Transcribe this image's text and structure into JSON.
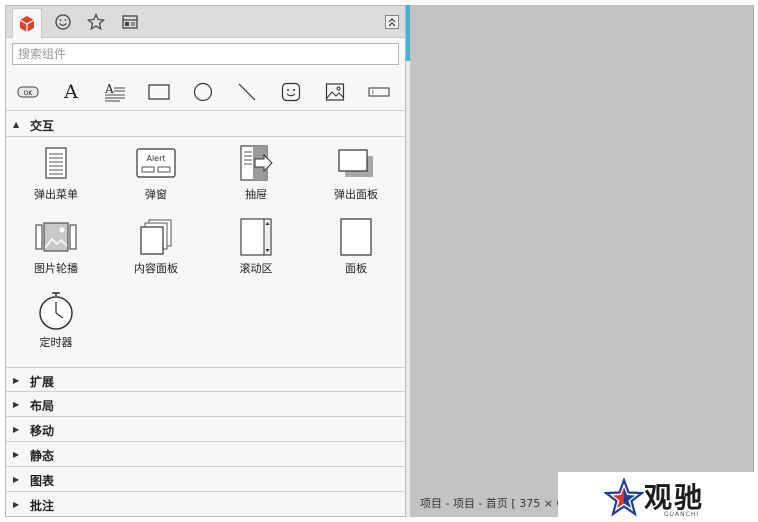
{
  "panel": {
    "tabs": [
      {
        "icon": "cube-icon"
      },
      {
        "icon": "smiley-icon"
      },
      {
        "icon": "star-icon"
      },
      {
        "icon": "layout-icon"
      }
    ],
    "collapse_icon": "double-chevron-up-icon",
    "search_placeholder": "搜索组件",
    "quickbar": [
      {
        "icon": "button-ok-icon",
        "text": "OK"
      },
      {
        "icon": "text-icon",
        "text": "A"
      },
      {
        "icon": "paragraph-icon",
        "text": "A"
      },
      {
        "icon": "rectangle-icon"
      },
      {
        "icon": "circle-icon"
      },
      {
        "icon": "line-icon"
      },
      {
        "icon": "smiley-shape-icon"
      },
      {
        "icon": "image-icon"
      },
      {
        "icon": "input-field-icon",
        "text": "I"
      }
    ],
    "expanded_section": {
      "label": "交互",
      "items": [
        {
          "label": "弹出菜单",
          "icon": "popup-menu-icon"
        },
        {
          "label": "弹窗",
          "icon": "alert-dialog-icon",
          "icon_text": "Alert"
        },
        {
          "label": "抽屉",
          "icon": "drawer-icon"
        },
        {
          "label": "弹出面板",
          "icon": "popup-panel-icon"
        },
        {
          "label": "图片轮播",
          "icon": "image-carousel-icon"
        },
        {
          "label": "内容面板",
          "icon": "content-panel-icon"
        },
        {
          "label": "滚动区",
          "icon": "scroll-area-icon"
        },
        {
          "label": "面板",
          "icon": "panel-icon"
        },
        {
          "label": "定时器",
          "icon": "timer-icon"
        }
      ]
    },
    "collapsed_sections": [
      {
        "label": "扩展"
      },
      {
        "label": "布局"
      },
      {
        "label": "移动"
      },
      {
        "label": "静态"
      },
      {
        "label": "图表"
      },
      {
        "label": "批注"
      }
    ]
  },
  "canvas": {
    "status": "项目 - 项目 - 首页 [ 375 × 6"
  },
  "watermark": {
    "text": "观驰",
    "subtext": "GUANCHI"
  },
  "colors": {
    "accent": "#3bb6d8",
    "brand_red": "#d9452b",
    "canvas": "#c3c3c3",
    "panel_bg": "#f7f7f7"
  }
}
